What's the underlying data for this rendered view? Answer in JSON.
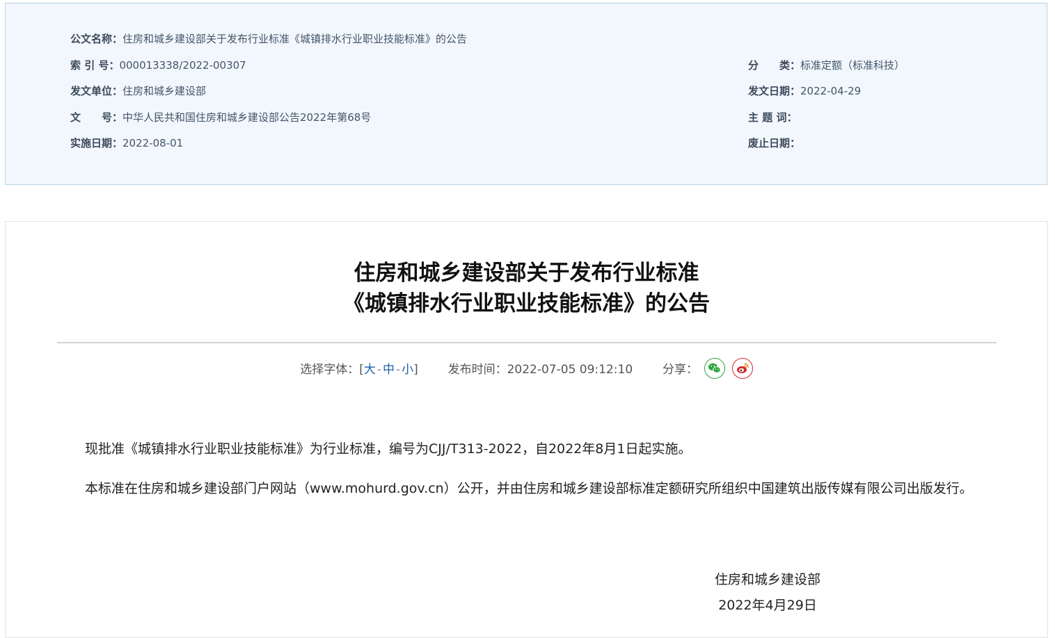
{
  "meta": {
    "title_label": "公文名称：",
    "title_value": "住房和城乡建设部关于发布行业标准《城镇排水行业职业技能标准》的公告",
    "index_label": "索 引 号：",
    "index_value": "000013338/2022-00307",
    "category_label": "分　　类：",
    "category_value": "标准定额（标准科技）",
    "issuer_label": "发文单位：",
    "issuer_value": "住房和城乡建设部",
    "issue_date_label": "发文日期：",
    "issue_date_value": "2022-04-29",
    "doc_no_label": "文　　号：",
    "doc_no_value": "中华人民共和国住房和城乡建设部公告2022年第68号",
    "keywords_label": "主 题 词：",
    "keywords_value": "",
    "effective_label": "实施日期：",
    "effective_value": "2022-08-01",
    "expiry_label": "废止日期：",
    "expiry_value": ""
  },
  "article": {
    "title_line1": "住房和城乡建设部关于发布行业标准",
    "title_line2": "《城镇排水行业职业技能标准》的公告",
    "font_select_label": "选择字体：[",
    "font_large": "大",
    "font_medium": "中",
    "font_small": "小",
    "font_sep": "-",
    "font_select_end": "]",
    "publish_label": "发布时间：",
    "publish_time": "2022-07-05 09:12:10",
    "share_label": "分享：",
    "paragraph1": "现批准《城镇排水行业职业技能标准》为行业标准，编号为CJJ/T313-2022，自2022年8月1日起实施。",
    "paragraph2": "本标准在住房和城乡建设部门户网站（www.mohurd.gov.cn）公开，并由住房和城乡建设部标准定额研究所组织中国建筑出版传媒有限公司出版发行。",
    "signature_org": "住房和城乡建设部",
    "signature_date": "2022年4月29日"
  },
  "icons": {
    "share_wechat": "wechat-icon",
    "share_weibo": "weibo-icon"
  },
  "colors": {
    "meta_background": "#f1f7fc",
    "meta_border": "#b9d3e6",
    "link": "#1f5fa8",
    "wechat": "#2aa63a",
    "weibo": "#d4262b"
  }
}
